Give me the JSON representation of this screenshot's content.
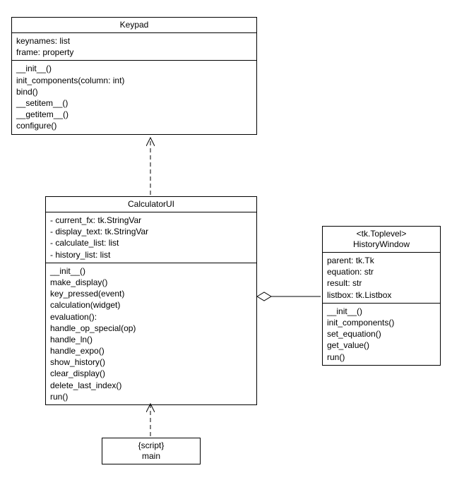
{
  "classes": {
    "keypad": {
      "title": "Keypad",
      "attrs": [
        "keynames: list",
        "frame: property"
      ],
      "ops": [
        "__init__()",
        "init_components(column: int)",
        "bind()",
        "__setitem__()",
        "__getitem__()",
        "configure()"
      ]
    },
    "calculatorui": {
      "title": "CalculatorUI",
      "attrs": [
        "- current_fx: tk.StringVar",
        "- display_text: tk.StringVar",
        "- calculate_list: list",
        "- history_list: list"
      ],
      "ops": [
        "__init__()",
        "make_display()",
        "key_pressed(event)",
        "calculation(widget)",
        "evaluation():",
        "handle_op_special(op)",
        "handle_ln()",
        "handle_expo()",
        "show_history()",
        "clear_display()",
        "delete_last_index()",
        "run()"
      ]
    },
    "historywindow": {
      "stereotype": "<tk.Toplevel>",
      "title": "HistoryWindow",
      "attrs": [
        "parent: tk.Tk",
        "equation: str",
        "result: str",
        "listbox: tk.Listbox"
      ],
      "ops": [
        "__init__()",
        "init_components()",
        "set_equation()",
        "get_value()",
        "run()"
      ]
    },
    "main": {
      "stereotype": "{script}",
      "title": "main"
    }
  }
}
